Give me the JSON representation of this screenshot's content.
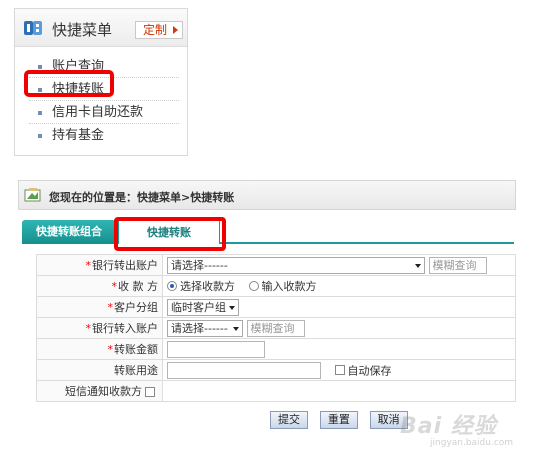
{
  "quick_menu": {
    "title": "快捷菜单",
    "customize_label": "定制",
    "items": [
      {
        "label": "账户查询"
      },
      {
        "label": "快捷转账"
      },
      {
        "label": "信用卡自助还款"
      },
      {
        "label": "持有基金"
      }
    ]
  },
  "location": {
    "text": "您现在的位置是：快捷菜单>快捷转账"
  },
  "tabs": [
    {
      "label": "快捷转账组合",
      "active": false
    },
    {
      "label": "快捷转账",
      "active": true
    }
  ],
  "form": {
    "rows": [
      {
        "label": "银行转出账户",
        "required": true
      },
      {
        "label": "收 款 方",
        "required": true
      },
      {
        "label": "客户分组",
        "required": true
      },
      {
        "label": "银行转入账户",
        "required": true
      },
      {
        "label": "转账金额",
        "required": true
      },
      {
        "label": "转账用途",
        "required": false
      },
      {
        "label": "短信通知收款方",
        "required": false
      }
    ],
    "out_account_select": "请选择------",
    "fuzzy_query_placeholder": "模糊查询",
    "payee_options": [
      {
        "label": "选择收款方",
        "selected": true
      },
      {
        "label": "输入收款方",
        "selected": false
      }
    ],
    "customer_group_select": "临时客户组",
    "in_account_select": "请选择------",
    "auto_save_label": "自动保存"
  },
  "buttons": {
    "submit": "提交",
    "reset": "重置",
    "cancel": "取消"
  },
  "watermark": {
    "text": "Bai 经验",
    "url": "jingyan.baidu.com"
  },
  "colors": {
    "highlight": "#f00000",
    "tab_active_fill": "#15908e",
    "accent_red": "#cc3300"
  }
}
